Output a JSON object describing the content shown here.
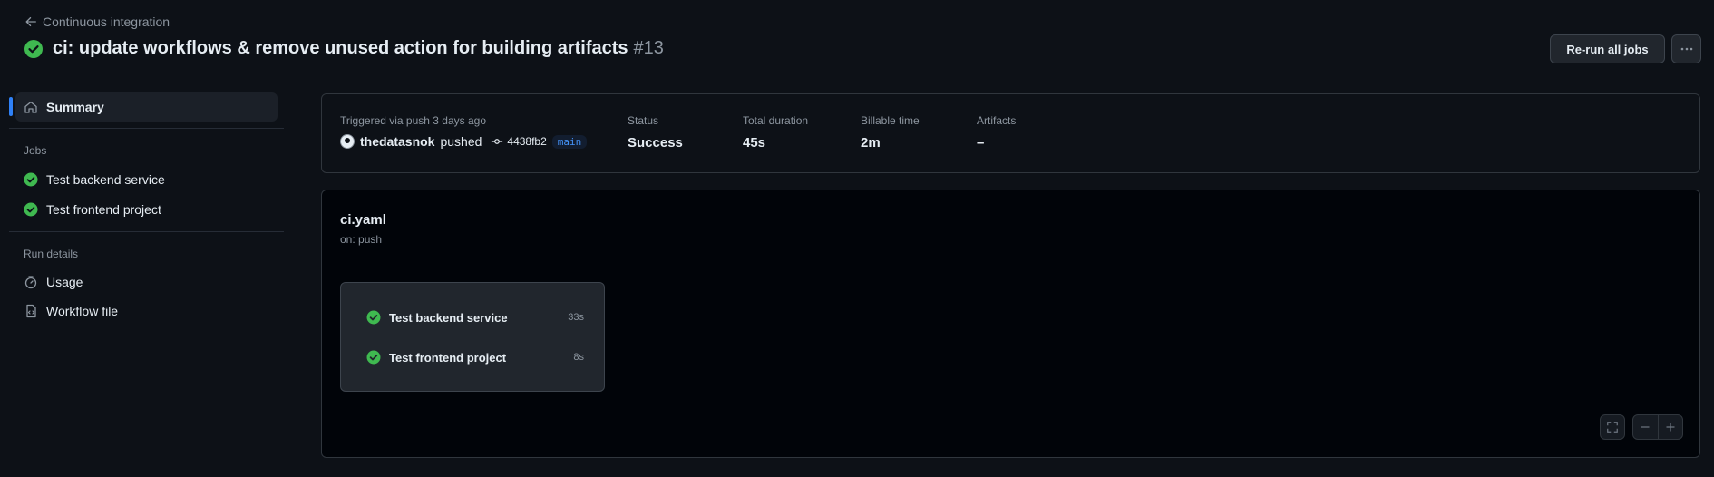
{
  "header": {
    "back_label": "Continuous integration",
    "title": "ci: update workflows & remove unused action for building artifacts",
    "run_number": "#13",
    "rerun_label": "Re-run all jobs"
  },
  "sidebar": {
    "summary_label": "Summary",
    "jobs_heading": "Jobs",
    "jobs": [
      {
        "label": "Test backend service"
      },
      {
        "label": "Test frontend project"
      }
    ],
    "run_details_heading": "Run details",
    "details": [
      {
        "label": "Usage"
      },
      {
        "label": "Workflow file"
      }
    ]
  },
  "summary": {
    "trigger_label": "Triggered via push 3 days ago",
    "actor": "thedatasnok",
    "action": "pushed",
    "commit": "4438fb2",
    "branch": "main",
    "status_label": "Status",
    "status_value": "Success",
    "duration_label": "Total duration",
    "duration_value": "45s",
    "billable_label": "Billable time",
    "billable_value": "2m",
    "artifacts_label": "Artifacts",
    "artifacts_value": "–"
  },
  "workflow": {
    "name": "ci.yaml",
    "trigger": "on: push",
    "jobs": [
      {
        "label": "Test backend service",
        "duration": "33s"
      },
      {
        "label": "Test frontend project",
        "duration": "8s"
      }
    ]
  },
  "colors": {
    "success": "#3fb950",
    "accent": "#2f81f7",
    "background": "#0d1117"
  }
}
